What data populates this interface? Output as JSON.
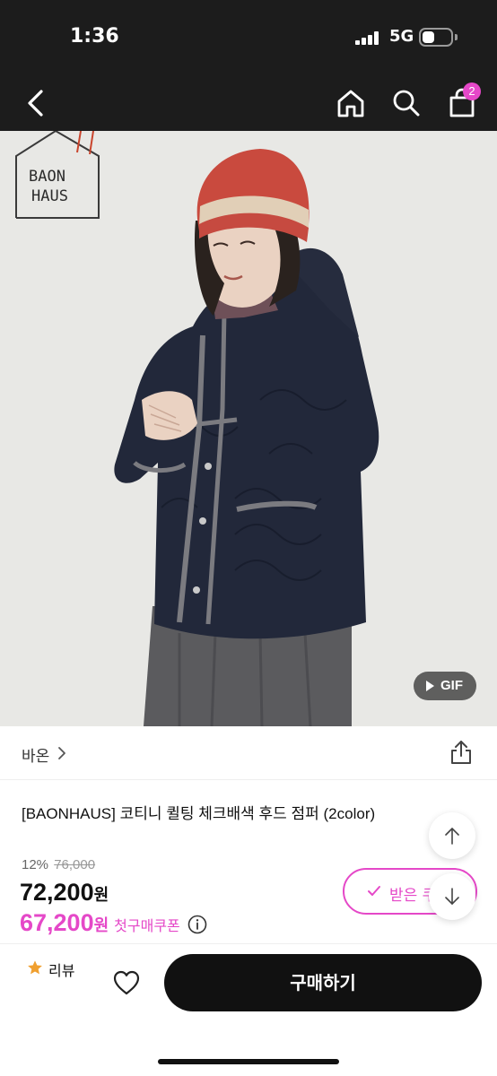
{
  "status_bar": {
    "time": "1:36",
    "network": "5G"
  },
  "nav": {
    "cart_count": "2",
    "icons": [
      "back-arrow-icon",
      "home-icon",
      "search-icon",
      "shopping-bag-icon"
    ]
  },
  "product_image": {
    "watermark_lines": [
      "BAON",
      "HAUS"
    ],
    "gif_label": "GIF"
  },
  "brand": {
    "name": "바온",
    "chevron": ">"
  },
  "product": {
    "title": "[BAONHAUS] 코티니 퀼팅 체크배색 후드 점퍼 (2color)",
    "discount_rate": "12%",
    "original_price": "76,000",
    "sale_price": "72,200",
    "sale_unit": "원",
    "coupon_price": "67,200",
    "coupon_unit": "원",
    "coupon_label": "첫구매쿠폰"
  },
  "coupon_button": {
    "label": "받은 쿠폰"
  },
  "bottom_bar": {
    "review_label": "리뷰",
    "purchase_label": "구매하기"
  },
  "colors": {
    "accent": "#e548c8",
    "header_bg": "#1c1c1c",
    "button_bg": "#111111",
    "star": "#f0a030"
  }
}
